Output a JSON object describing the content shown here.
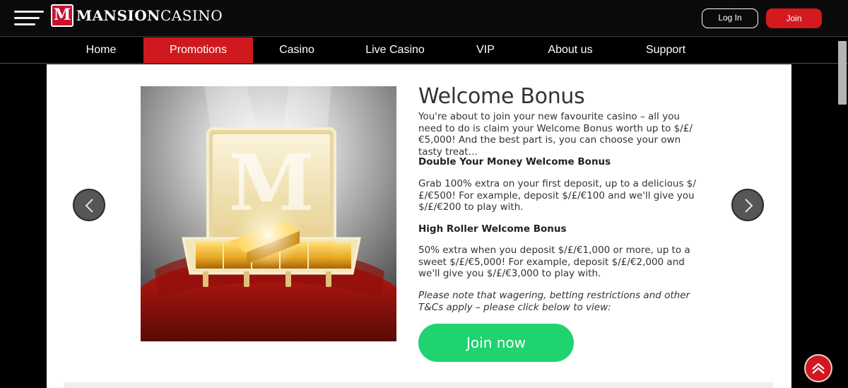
{
  "header": {
    "logo_letter": "M",
    "logo_text_bold": "MANSION",
    "logo_text": "CASINO",
    "login_label": "Log In",
    "join_label": "Join"
  },
  "nav": {
    "items": [
      {
        "label": "Home",
        "active": false
      },
      {
        "label": "Promotions",
        "active": true
      },
      {
        "label": "Casino",
        "active": false
      },
      {
        "label": "Live Casino",
        "active": false
      },
      {
        "label": "VIP",
        "active": false
      },
      {
        "label": "About us",
        "active": false
      },
      {
        "label": "Support",
        "active": false
      }
    ]
  },
  "promo": {
    "image_icon": "briefcase-gold-bars-image",
    "title": "Welcome Bonus",
    "intro": "You're about to join your new favourite casino – all you need to do is claim your Welcome Bonus worth up to $/£/€5,000! And the best part is, you can choose your own tasty treat…",
    "bonus1_title": "Double Your Money Welcome Bonus",
    "bonus1_text": "Grab 100% extra on your first deposit, up to a delicious $/£/€500! For example, deposit $/£/€100 and we'll give you $/£/€200 to play with.",
    "bonus2_title": "High Roller Welcome Bonus",
    "bonus2_text": "50% extra when you deposit $/£/€1,000 or more, up to a sweet $/£/€5,000! For example, deposit $/£/€2,000 and we'll give you $/£/€3,000 to play with.",
    "terms_note": "Please note that wagering, betting restrictions and other T&Cs apply – please click below to view:",
    "cta_label": "Join now"
  },
  "colors": {
    "brand_red": "#d0191e",
    "cta_green": "#1fd36f",
    "background": "#0b0b0b"
  },
  "icons": {
    "menu": "hamburger-icon",
    "prev": "chevron-left-icon",
    "next": "chevron-right-icon",
    "back_to_top": "chevron-up-icon"
  }
}
